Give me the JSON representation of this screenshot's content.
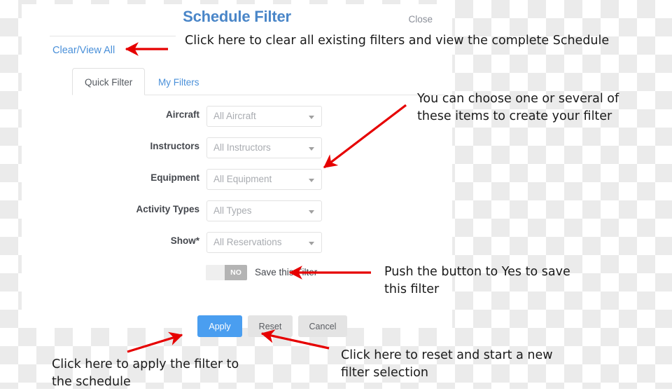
{
  "dialog": {
    "title": "Schedule Filter",
    "close_label": "Close",
    "clear_view_all_label": "Clear/View All",
    "title_color": "#4a86c8",
    "link_color": "#4a90d9"
  },
  "tabs": [
    {
      "label": "Quick Filter",
      "active": true
    },
    {
      "label": "My Filters",
      "active": false
    }
  ],
  "form": {
    "rows": [
      {
        "label": "Aircraft",
        "value": "All Aircraft"
      },
      {
        "label": "Instructors",
        "value": "All Instructors"
      },
      {
        "label": "Equipment",
        "value": "All Equipment"
      },
      {
        "label": "Activity Types",
        "value": "All Types"
      },
      {
        "label": "Show*",
        "value": "All Reservations"
      }
    ]
  },
  "toggle": {
    "state_label": "NO",
    "label": "Save this Filter",
    "on_color": "#4a9ef0",
    "off_color": "#b4b4b4"
  },
  "buttons": {
    "apply": "Apply",
    "reset": "Reset",
    "cancel": "Cancel",
    "apply_color": "#4a9ef0",
    "secondary_color": "#e4e4e4"
  },
  "annotations": {
    "arrow_color": "#e60000",
    "clear_view_all": "Click here to clear all existing filters and view the complete Schedule",
    "choose_items": "You can choose one or several of\nthese items to create your filter",
    "push_button": "Push the button to Yes to save\nthis filter",
    "apply_filter": "Click here to apply the filter to\nthe schedule",
    "reset_filter": "Click here to reset and start a new\nfilter selection"
  }
}
